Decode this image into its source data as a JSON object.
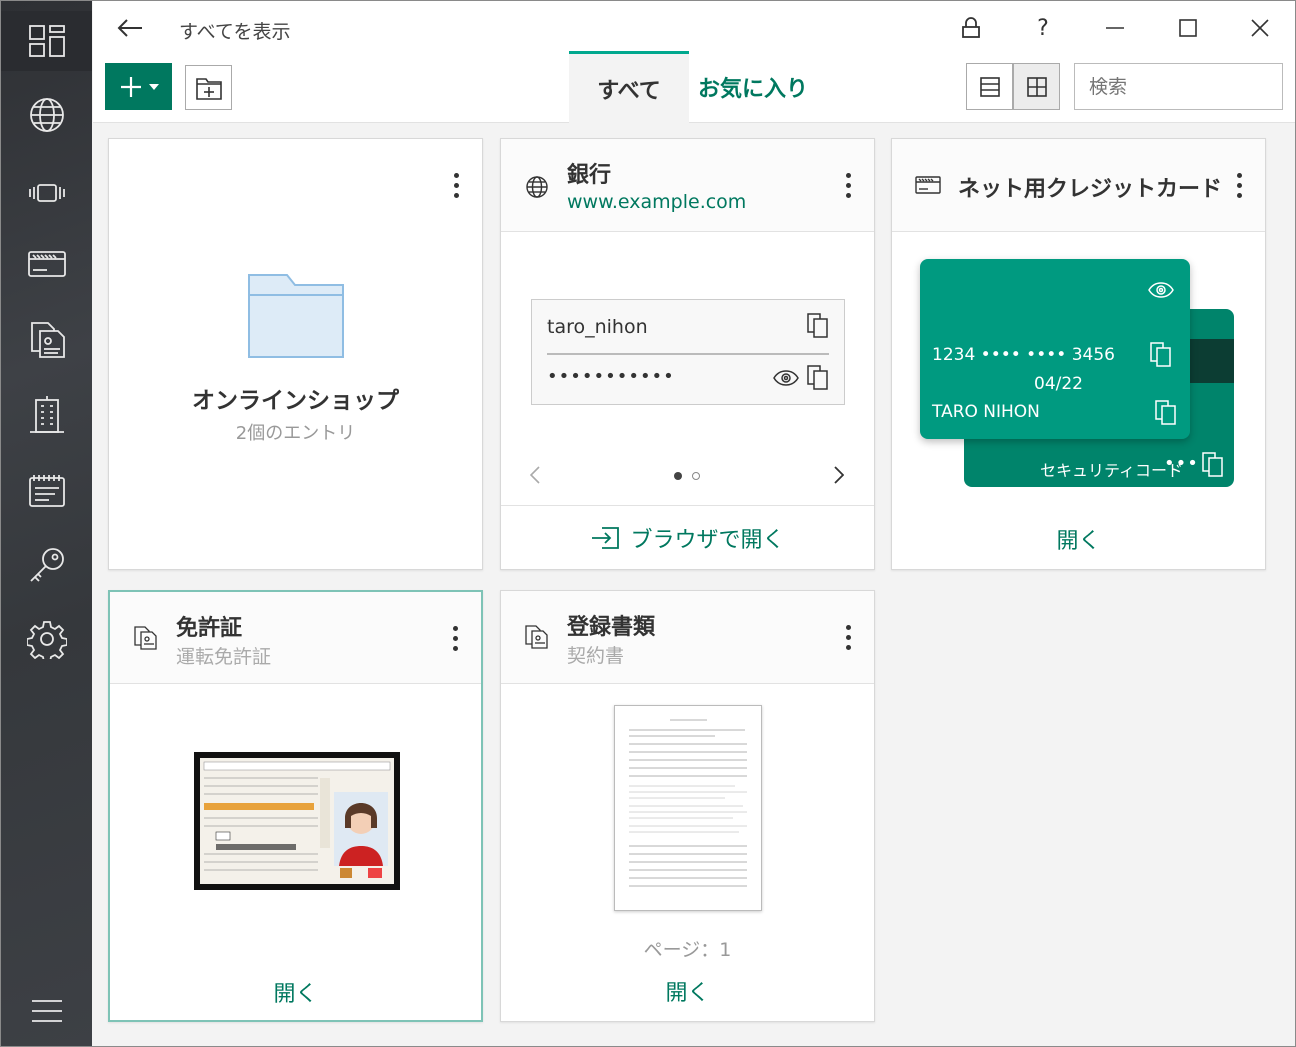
{
  "window": {
    "title": "すべてを表示",
    "lock_icon": "lock-icon",
    "help_label": "?",
    "minimize_icon": "minimize-icon",
    "maximize_icon": "maximize-icon",
    "close_icon": "close-icon"
  },
  "sidebar": {
    "items": [
      {
        "icon": "dashboard-icon",
        "active": true
      },
      {
        "icon": "globe-icon"
      },
      {
        "icon": "app-icon"
      },
      {
        "icon": "credit-card-icon"
      },
      {
        "icon": "document-icon"
      },
      {
        "icon": "building-icon"
      },
      {
        "icon": "note-icon"
      },
      {
        "icon": "key-icon"
      },
      {
        "icon": "settings-icon"
      }
    ],
    "menu_icon": "hamburger-menu-icon"
  },
  "toolbar": {
    "add_label": "+",
    "tabs": [
      {
        "label": "すべて",
        "active": true
      },
      {
        "label": "お気に入り"
      }
    ],
    "search_placeholder": "検索"
  },
  "cards": {
    "folder": {
      "title": "オンラインショップ",
      "subtitle": "2個のエントリ"
    },
    "bank": {
      "title": "銀行",
      "url": "www.example.com",
      "username": "taro_nihon",
      "password_mask": "•••••••••••",
      "pager": {
        "current": 1,
        "total": 2
      },
      "action": "ブラウザで開く"
    },
    "credit": {
      "title": "ネット用クレジットカード",
      "number": "1234 •••• •••• 3456",
      "expiry": "04/22",
      "holder": "TARO NIHON",
      "security_label": "セキュリティコード",
      "security_mask": "•••",
      "action": "開く"
    },
    "license": {
      "title": "免許証",
      "subtitle": "運転免許証",
      "action": "開く"
    },
    "registration": {
      "title": "登録書類",
      "subtitle": "契約書",
      "pages": "ページ：1",
      "action": "開く"
    }
  },
  "colors": {
    "accent": "#00785f",
    "card_green": "#009a80",
    "sidebar": "#3a3d42"
  }
}
